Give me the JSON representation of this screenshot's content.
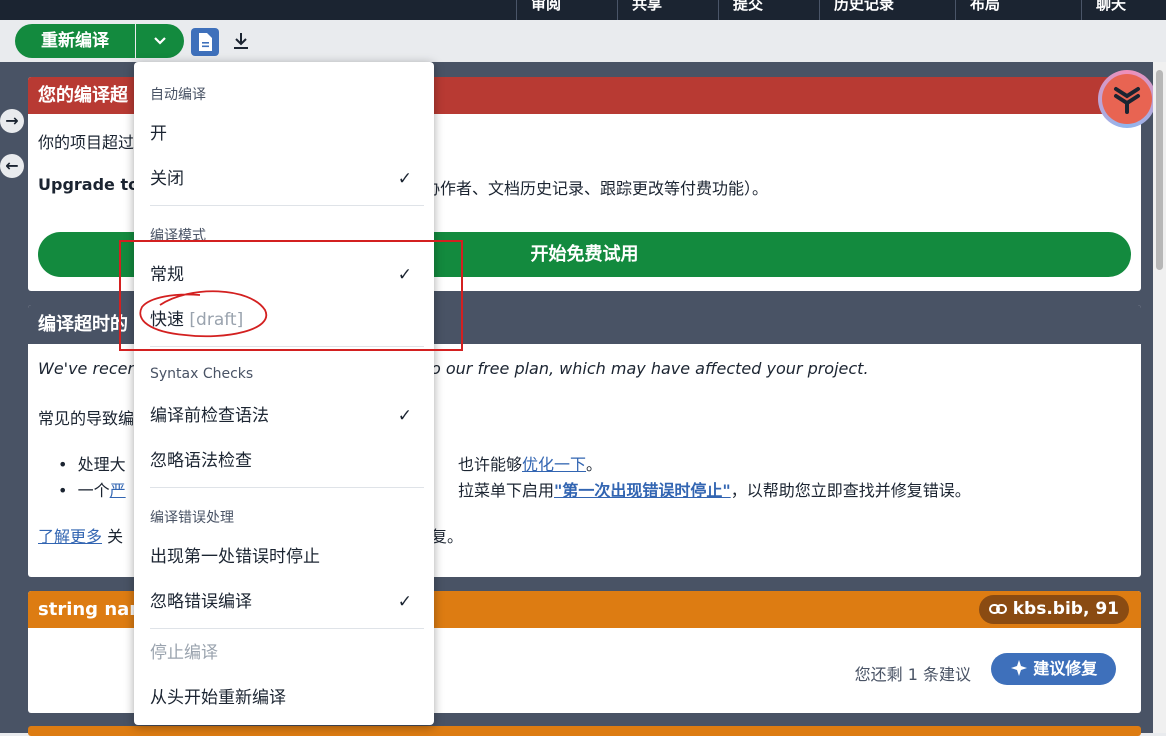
{
  "topbar": {
    "buttons": [
      "审阅",
      "共享",
      "提交",
      "历史记录",
      "布局",
      "聊天"
    ]
  },
  "toolbar": {
    "recompile_label": "重新编译"
  },
  "card1": {
    "title": "您的编译超",
    "line1": "你的项目超过",
    "line2_bold": "Upgrade to",
    "line2_rest": "协作者、文档历史记录、跟踪更改等付费功能）。",
    "cta": "开始免费试用"
  },
  "card2": {
    "title": "编译超时的",
    "line1_a": "We've recent",
    "line1_b": "o our free plan, which may have affected your project.",
    "line2": "常见的导致编",
    "bullet1_a": "处理大",
    "bullet1_b": "也许能够",
    "bullet1_link": "优化一下",
    "bullet1_end": "。",
    "bullet2_a": "一个",
    "bullet2_link_a": "严",
    "bullet2_b": "拉菜单下启用",
    "bullet2_link_b": "\"第一次出现错误时停止\"",
    "bullet2_end": "，以帮助您立即查找并修复错误。",
    "learn_more": "了解更多",
    "learn_more_a": "关",
    "learn_more_b": "复。"
  },
  "card3": {
    "title": "string nam",
    "badge": "kbs.bib, 91",
    "remaining": "您还剩 1 条建议",
    "suggest_btn": "建议修复"
  },
  "menu": {
    "section_auto": "自动编译",
    "auto_on": "开",
    "auto_off": "关闭",
    "section_mode": "编译模式",
    "mode_normal": "常规",
    "mode_fast": "快速",
    "mode_fast_tag": "[draft]",
    "section_syntax": "Syntax Checks",
    "syntax_check": "编译前检查语法",
    "syntax_ignore": "忽略语法检查",
    "section_error": "编译错误处理",
    "error_stop": "出现第一处错误时停止",
    "error_ignore": "忽略错误编译",
    "stop_compile": "停止编译",
    "recompile_scratch": "从头开始重新编译",
    "check_glyph": "✓"
  },
  "colors": {
    "green": "#138a3e",
    "red": "#b83a33",
    "orange": "#dd7c12",
    "blue": "#3e70bb",
    "slate": "#495365"
  }
}
